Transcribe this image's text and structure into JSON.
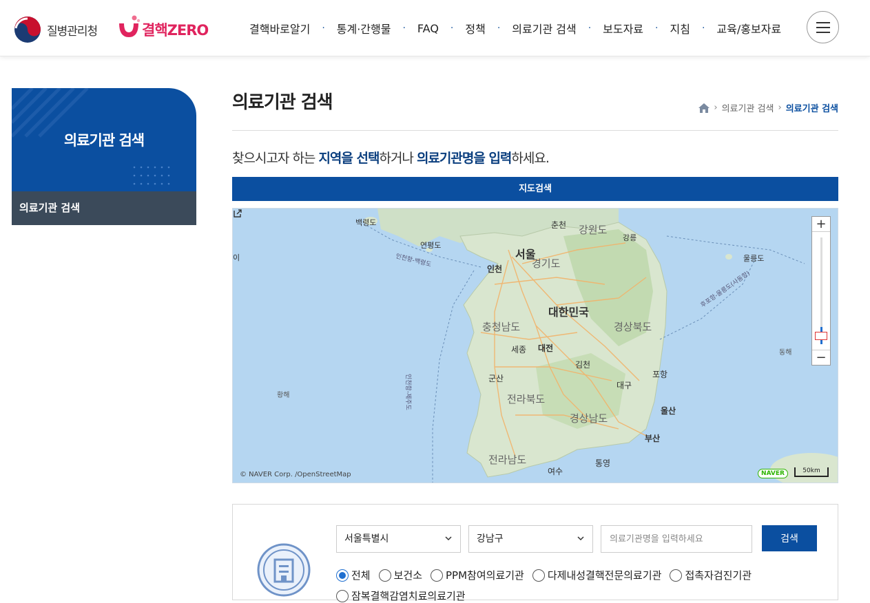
{
  "header": {
    "org_name": "질병관리청",
    "campaign_name": "결핵ZERO",
    "nav": [
      "결핵바로알기",
      "통계·간행물",
      "FAQ",
      "정책",
      "의료기관 검색",
      "보도자료",
      "지침",
      "교육/홍보자료"
    ],
    "menu_icon": "hamburger-icon"
  },
  "sidebar": {
    "title": "의료기관 검색",
    "items": [
      "의료기관 검색"
    ]
  },
  "page": {
    "title": "의료기관 검색",
    "breadcrumb": [
      "의료기관 검색",
      "의료기관 검색"
    ],
    "instruction": {
      "p1": "찾으시고자 하는 ",
      "h1": "지역을 선택",
      "p2": "하거나 ",
      "h2": "의료기관명을 입력",
      "p3": "하세요."
    }
  },
  "map": {
    "bar_label": "지도검색",
    "labels": {
      "baengnyeong": "백령도",
      "chuncheon": "춘천",
      "gangwon": "강원도",
      "gangneung": "강릉",
      "yeonpyeong": "연평도",
      "seoul": "서울",
      "gyeonggi": "경기도",
      "ulleung": "울릉도",
      "incheon_route": "인천항-백령도",
      "incheon": "인천",
      "left_edge": "이",
      "hupo_route": "후포항-울릉도(사동항)",
      "korea": "대한민국",
      "chungnam": "충청남도",
      "gyeongbuk": "경상북도",
      "sejong": "세종",
      "daejeon": "대전",
      "east_sea": "동해",
      "gimcheon": "김천",
      "pohang": "포항",
      "jeju_route": "인천항-제주도",
      "gunsan": "군산",
      "daegu": "대구",
      "yellow_sea": "황해",
      "jeonbuk": "전라북도",
      "ulsan": "울산",
      "gyeongnam": "경상남도",
      "busan": "부산",
      "jeonnam": "전라남도",
      "tongyeong": "통영",
      "yeosu": "여수"
    },
    "zoom_in": "+",
    "zoom_out": "−",
    "attribution": "© NAVER Corp. /OpenStreetMap",
    "naver_badge": "NAVER",
    "scale": "50km"
  },
  "search": {
    "region": "서울특별시",
    "district": "강남구",
    "name_placeholder": "의료기관명을 입력하세요",
    "button": "검색",
    "types": [
      "전체",
      "보건소",
      "PPM참여의료기관",
      "다제내성결핵전문의료기관",
      "접촉자검진기관"
    ],
    "selected_type": "전체",
    "second_row_text": "잠복결핵감염치료의료기관"
  }
}
